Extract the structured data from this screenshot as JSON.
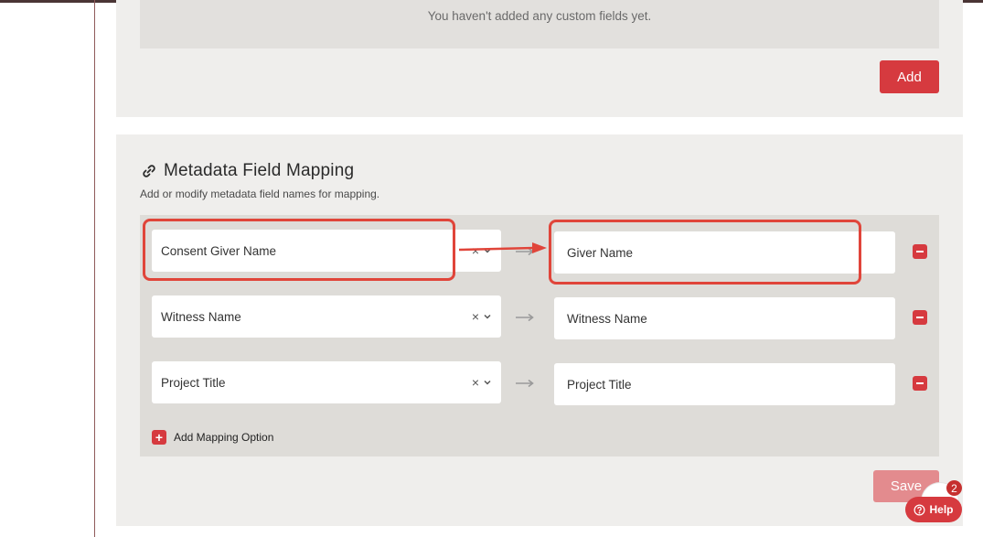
{
  "custom_fields": {
    "empty_text": "You haven't added any custom fields yet.",
    "add_label": "Add"
  },
  "mapping": {
    "title": "Metadata Field Mapping",
    "subtitle": "Add or modify metadata field names for mapping.",
    "rows": [
      {
        "source": "Consent Giver Name",
        "target": "Giver Name"
      },
      {
        "source": "Witness Name",
        "target": "Witness Name"
      },
      {
        "source": "Project Title",
        "target": "Project Title"
      }
    ],
    "clear_glyph": "×",
    "arrow_glyph": "⟶",
    "add_option_label": "Add Mapping Option",
    "save_label": "Save"
  },
  "help": {
    "label": "Help",
    "badge_count": "2"
  },
  "colors": {
    "accent": "#d63a3f",
    "annotation": "#e0453a",
    "panel_bg": "#efeeec",
    "mapping_bg": "#dedcd8"
  }
}
